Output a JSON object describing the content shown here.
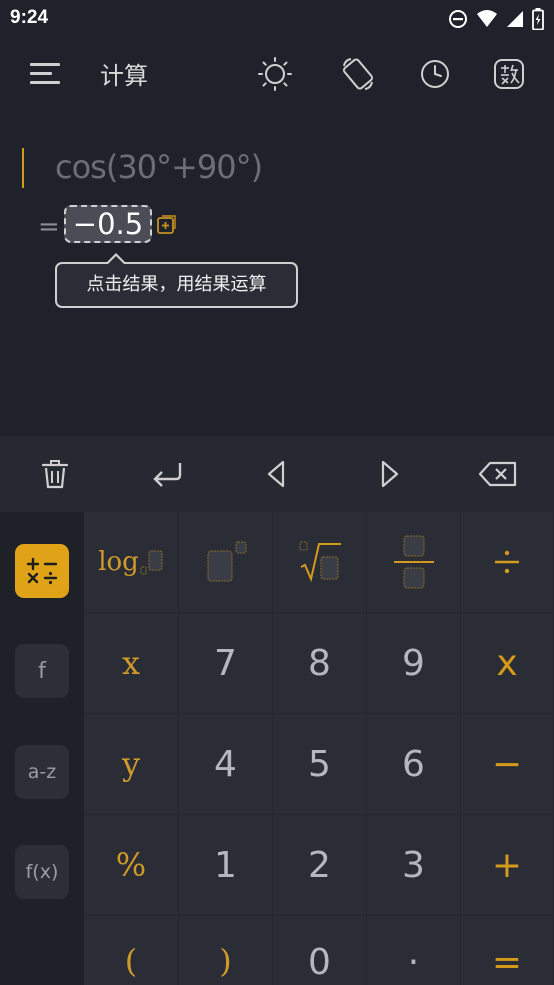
{
  "status_bar": {
    "time": "9:24"
  },
  "app_bar": {
    "title": "计算"
  },
  "expression": {
    "text": "cos(30°+90°)",
    "equals": "=",
    "result": "−0.5"
  },
  "tooltip": {
    "text": "点击结果，用结果运算"
  },
  "colors": {
    "accent": "#d49a1a",
    "background": "#1f222a",
    "keypad": "#2a2d35"
  },
  "categories": [
    {
      "label": "+−×÷",
      "active": true
    },
    {
      "label": "f",
      "active": false
    },
    {
      "label": "a-z",
      "active": false
    },
    {
      "label": "f(x)",
      "active": false
    }
  ],
  "keypad": {
    "row1": {
      "log_label": "log"
    },
    "row2": [
      "x",
      "7",
      "8",
      "9",
      "x"
    ],
    "row3": [
      "y",
      "4",
      "5",
      "6",
      "−"
    ],
    "row4": [
      "%",
      "1",
      "2",
      "3",
      "+"
    ],
    "row5": [
      "(",
      ")",
      "0",
      "·",
      "="
    ]
  }
}
